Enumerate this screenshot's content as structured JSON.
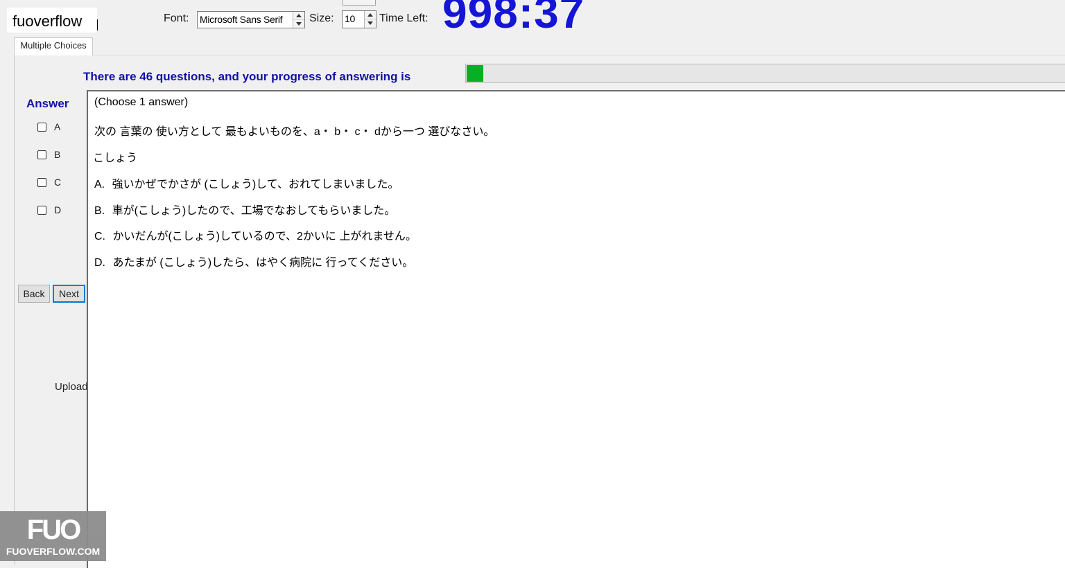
{
  "brand": {
    "label": "fuoverflow"
  },
  "toolbar": {
    "font_label": "Font:",
    "font_value": "Microsoft Sans Serif",
    "size_label": "Size:",
    "size_value": "10",
    "time_left_label": "Time Left:",
    "time_left_value": "998:37"
  },
  "tabs": [
    {
      "label": "Multiple Choices",
      "selected": true
    }
  ],
  "progress": {
    "text": "There are 46 questions, and your progress of answering is",
    "fraction": 0.028,
    "fill_color": "#06b025"
  },
  "answer_panel": {
    "title": "Answer",
    "options": [
      {
        "letter": "A",
        "checked": false
      },
      {
        "letter": "B",
        "checked": false
      },
      {
        "letter": "C",
        "checked": false
      },
      {
        "letter": "D",
        "checked": false
      }
    ]
  },
  "nav": {
    "back_label": "Back",
    "next_label": "Next"
  },
  "status": {
    "uploaded_label": "Uploaded"
  },
  "question": {
    "instruction": "(Choose 1 answer)",
    "prompt": "次の 言葉の 使い方として 最もよいものを、a・ b・ c・ dから一つ 選びなさい。",
    "word": "こしょう",
    "choices": [
      {
        "prefix": "A.",
        "text": "強いかぜでかさが (こしょう)して、おれてしまいました。"
      },
      {
        "prefix": "B.",
        "text": "車が(こしょう)したので、工場でなおしてもらいました。"
      },
      {
        "prefix": "C.",
        "text": "かいだんが(こしょう)しているので、2かいに 上がれません。"
      },
      {
        "prefix": "D.",
        "text": "あたまが (こしょう)したら、はやく病院に 行ってください。"
      }
    ]
  },
  "watermark": {
    "logo": "FUO",
    "site": "FUOVERFLOW.COM"
  },
  "colors": {
    "timer": "#1515d6",
    "heading_blue": "#1111aa"
  }
}
